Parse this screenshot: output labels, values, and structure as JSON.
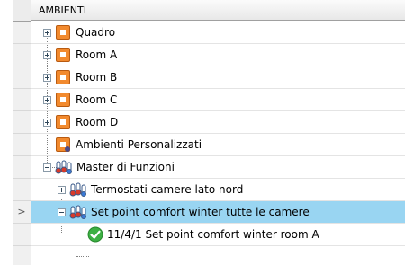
{
  "header": {
    "column_title": "AMBIENTI"
  },
  "row_header": {
    "current_row_marker": ">"
  },
  "tree": {
    "items": [
      {
        "label": "Quadro",
        "icon": "room-icon",
        "expander": "plus"
      },
      {
        "label": "Room A",
        "icon": "room-icon",
        "expander": "plus"
      },
      {
        "label": "Room B",
        "icon": "room-icon",
        "expander": "plus"
      },
      {
        "label": "Room C",
        "icon": "room-icon",
        "expander": "plus"
      },
      {
        "label": "Room D",
        "icon": "room-icon",
        "expander": "plus"
      },
      {
        "label": "Ambienti Personalizzati",
        "icon": "custom-room-icon",
        "expander": "none"
      },
      {
        "label": "Master di Funzioni",
        "icon": "thermostat-group-icon",
        "expander": "minus"
      },
      {
        "label": "Termostati camere lato nord",
        "icon": "thermostat-group-icon",
        "expander": "plus"
      },
      {
        "label": "Set point comfort winter tutte le camere",
        "icon": "thermostat-group-icon",
        "expander": "minus",
        "selected": true
      },
      {
        "label": "11/4/1 Set point comfort winter room A",
        "icon": "check-icon",
        "expander": "none"
      }
    ]
  },
  "colors": {
    "selection": "#99d5f2",
    "room_icon": "#f28a2e",
    "check": "#3cb043"
  }
}
